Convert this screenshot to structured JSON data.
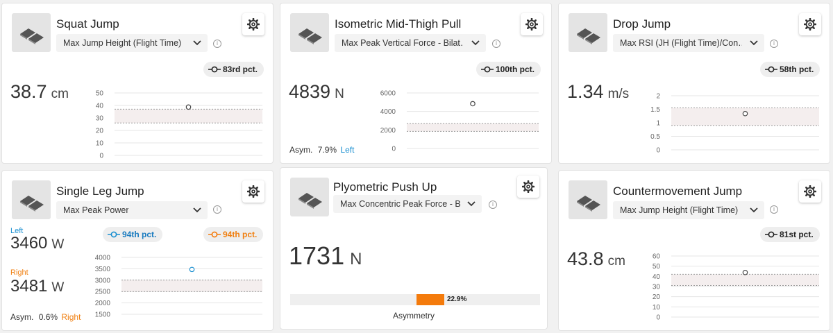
{
  "cards": [
    {
      "title": "Squat Jump",
      "metric": "Max Jump Height (Flight Time)",
      "percentile": "83rd pct.",
      "value": "38.7",
      "unit": "cm",
      "chart": {
        "ticks": [
          "50",
          "40",
          "30",
          "20",
          "10",
          "0"
        ],
        "ymin": 0,
        "ymax": 50,
        "band": [
          26,
          37
        ],
        "point": 38.7
      }
    },
    {
      "title": "Isometric Mid-Thigh Pull",
      "metric": "Max Peak Vertical Force - Bilat…",
      "percentile": "100th pct.",
      "value": "4839",
      "unit": "N",
      "asym_label": "Asym.",
      "asym_value": "7.9%",
      "asym_side": "Left",
      "chart": {
        "ticks": [
          "6000",
          "4000",
          "2000",
          "0"
        ],
        "ymin": 0,
        "ymax": 6000,
        "band": [
          1850,
          2700
        ],
        "point": 4839
      }
    },
    {
      "title": "Drop Jump",
      "metric": "Max RSI (JH (Flight Time)/Con…",
      "percentile": "58th pct.",
      "value": "1.34",
      "unit": "m/s",
      "chart": {
        "ticks": [
          "2",
          "1.5",
          "1",
          "0.5",
          "0"
        ],
        "ymin": 0,
        "ymax": 2,
        "band": [
          0.9,
          1.55
        ],
        "point": 1.34
      }
    },
    {
      "title": "Single Leg Jump",
      "metric": "Max Peak Power",
      "percentile_left": "94th pct.",
      "percentile_right": "94th pct.",
      "left_label": "Left",
      "left_value": "3460",
      "right_label": "Right",
      "right_value": "3481",
      "unit": "W",
      "asym_label": "Asym.",
      "asym_value": "0.6%",
      "asym_side": "Right",
      "chart": {
        "ticks": [
          "4000",
          "3500",
          "3000",
          "2500",
          "2000",
          "1500"
        ],
        "ymin": 1500,
        "ymax": 4000,
        "band": [
          2500,
          3000
        ],
        "point": 3470
      }
    },
    {
      "title": "Plyometric Push Up",
      "metric": "Max Concentric Peak Force - Bi…",
      "value": "1731",
      "unit": "N",
      "asymmetry_value": "22.9%",
      "asymmetry_caption": "Asymmetry"
    },
    {
      "title": "Countermovement Jump",
      "metric": "Max Jump Height (Flight Time)",
      "percentile": "81st pct.",
      "value": "43.8",
      "unit": "cm",
      "chart": {
        "ticks": [
          "60",
          "50",
          "40",
          "30",
          "20",
          "10",
          "0"
        ],
        "ymin": 0,
        "ymax": 60,
        "band": [
          31,
          42
        ],
        "point": 43.8
      }
    }
  ],
  "colors": {
    "blue": "#1a8fd0",
    "orange": "#f47b0c",
    "band": "#f4eeee",
    "band_line": "#999999"
  },
  "icons": [
    "exercise-thumbnail-icon",
    "gear-icon",
    "chevron-down-icon",
    "info-icon",
    "percentile-icon"
  ]
}
